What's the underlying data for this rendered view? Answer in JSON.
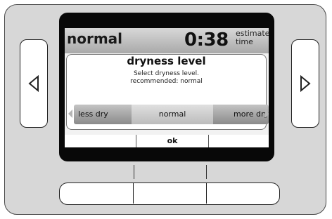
{
  "status": {
    "cycle": "normal",
    "time": "0:38",
    "time_label_line1": "estimated",
    "time_label_line2": "time"
  },
  "dialog": {
    "title": "dryness level",
    "message_line1": "Select dryness level.",
    "message_line2": "recommended: normal",
    "options": [
      "less dry",
      "normal",
      "more dry"
    ],
    "selected": "normal"
  },
  "softkeys": [
    "",
    "ok",
    ""
  ],
  "icons": {
    "left_button": "triangle-left-icon",
    "right_button": "triangle-right-icon"
  }
}
